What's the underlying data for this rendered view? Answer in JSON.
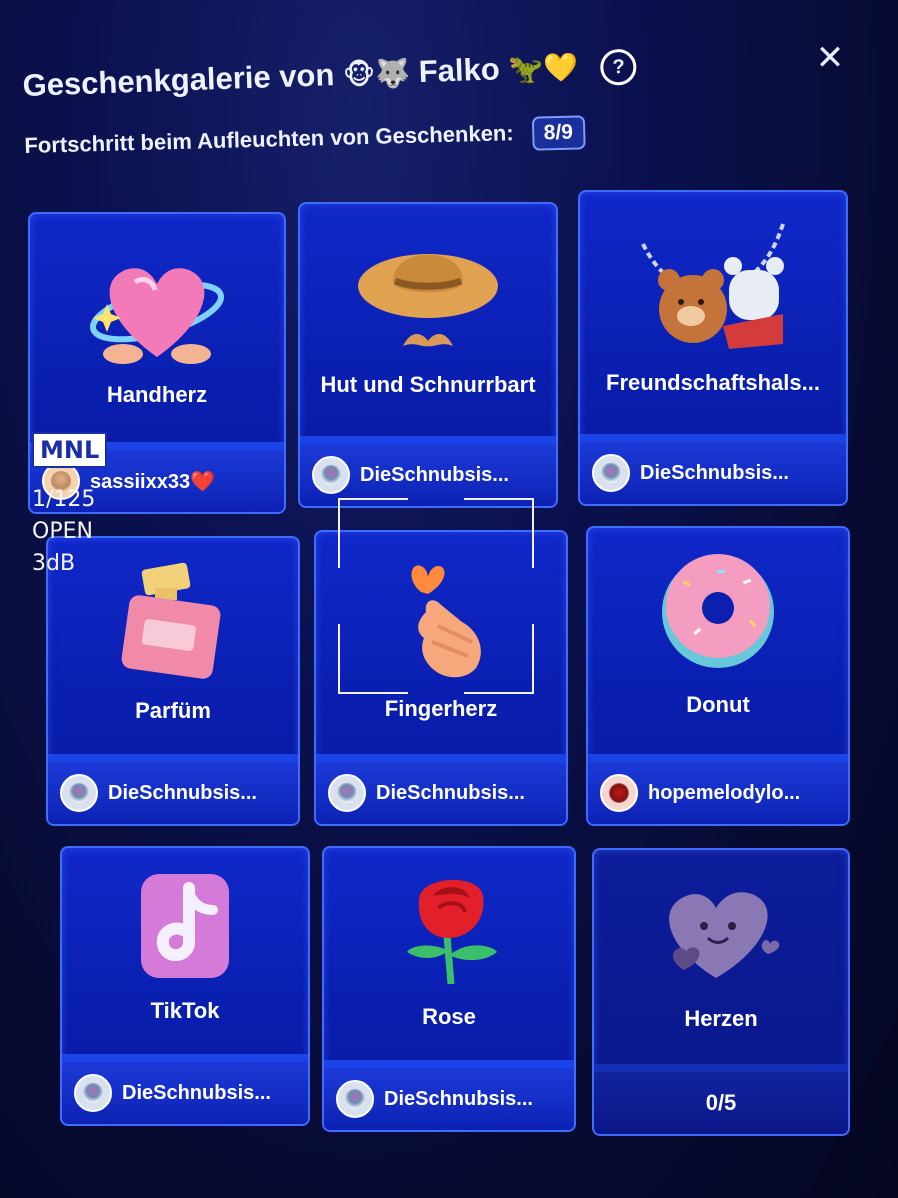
{
  "header": {
    "title": "Geschenkgalerie von",
    "title_emojis_before": "🐵🐺",
    "title_name": "Falko",
    "title_emojis_after": "🦖💛",
    "help_icon": "?",
    "close_icon": "✕",
    "progress_label": "Fortschritt beim Aufleuchten von Geschenken:",
    "progress_value": "8/9"
  },
  "gifts": [
    {
      "name": "Handherz",
      "user": "sassiixx33❤️",
      "icon": "heart-hands-icon"
    },
    {
      "name": "Hut und Schnurrbart",
      "user": "DieSchnubsis...",
      "icon": "hat-mustache-icon"
    },
    {
      "name": "Freundschaftshals...",
      "user": "DieSchnubsis...",
      "icon": "bears-necklace-icon"
    },
    {
      "name": "Parfüm",
      "user": "DieSchnubsis...",
      "icon": "perfume-icon"
    },
    {
      "name": "Fingerherz",
      "user": "DieSchnubsis...",
      "icon": "finger-heart-icon"
    },
    {
      "name": "Donut",
      "user": "hopemelodylo...",
      "icon": "donut-icon"
    },
    {
      "name": "TikTok",
      "user": "DieSchnubsis...",
      "icon": "tiktok-icon"
    },
    {
      "name": "Rose",
      "user": "DieSchnubsis...",
      "icon": "rose-icon"
    },
    {
      "name": "Herzen",
      "count": "0/5",
      "icon": "hearts-icon"
    }
  ],
  "camera_overlay": {
    "mode": "MNL",
    "frame": "1/125",
    "aperture": "OPEN",
    "gain": "3dB"
  }
}
